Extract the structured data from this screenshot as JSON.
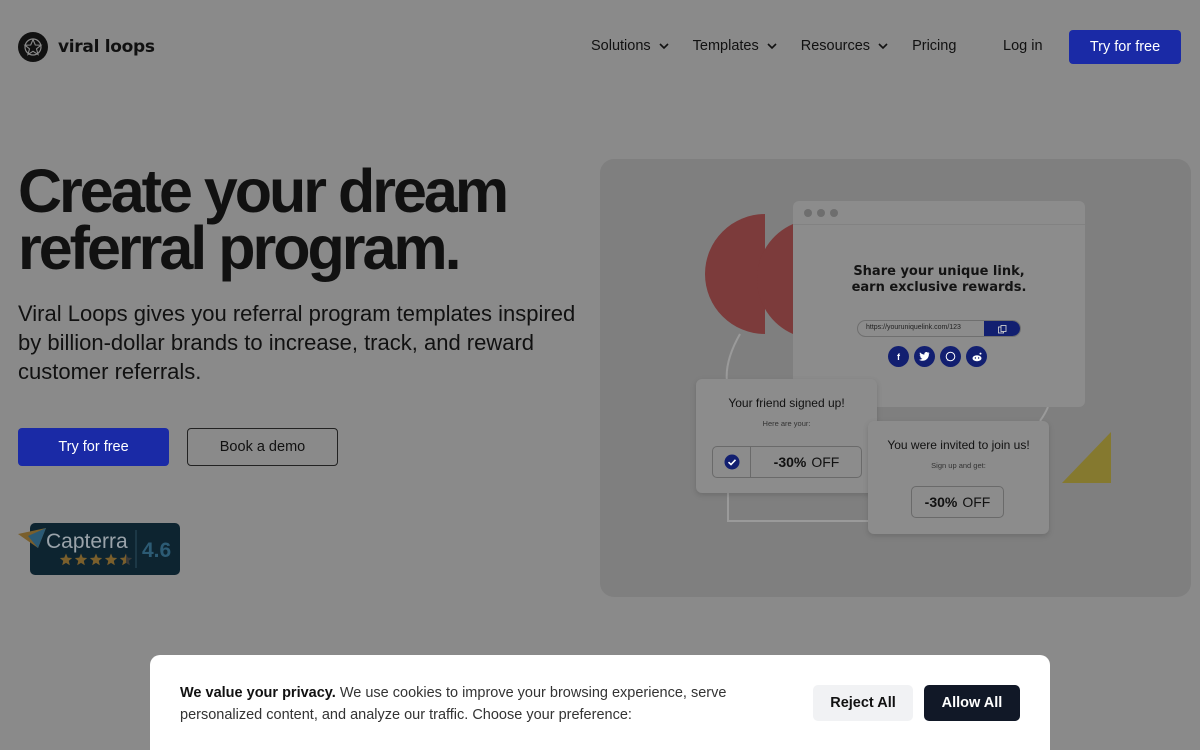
{
  "header": {
    "logo_text": "viral loops",
    "menu": [
      {
        "label": "Solutions",
        "has_dropdown": true
      },
      {
        "label": "Templates",
        "has_dropdown": true
      },
      {
        "label": "Resources",
        "has_dropdown": true
      },
      {
        "label": "Pricing",
        "has_dropdown": false
      }
    ],
    "login_label": "Log in",
    "cta_label": "Try for free"
  },
  "hero": {
    "title_line1": "Create your dream",
    "title_line2": "referral program.",
    "subtitle": "Viral Loops gives you referral program templates inspired by billion-dollar brands to increase, track, and reward customer referrals.",
    "primary_cta": "Try for free",
    "secondary_cta": "Book a demo"
  },
  "capterra": {
    "brand": "Capterra",
    "rating": "4.6",
    "stars": 4.5
  },
  "illustration": {
    "share_title_line1": "Share your unique link,",
    "share_title_line2": "earn exclusive rewards.",
    "link_text": "https://youruniquelink.com/123",
    "social_icons": [
      "facebook-icon",
      "twitter-icon",
      "whatsapp-icon",
      "reddit-icon"
    ],
    "card1": {
      "title": "Your friend signed up!",
      "subtitle": "Here are your:",
      "discount": "-30%",
      "discount_suffix": "OFF"
    },
    "card2": {
      "title": "You were invited to join us!",
      "subtitle": "Sign up and get:",
      "discount": "-30%",
      "discount_suffix": "OFF"
    }
  },
  "cookie": {
    "lead": "We value your privacy.",
    "text": "We use cookies to improve your browsing experience, serve personalized content, and analyze our traffic. Choose your preference:",
    "reject_label": "Reject All",
    "allow_label": "Allow All"
  },
  "colors": {
    "primary": "#1a2aa6",
    "overlay_bg": "#8a8a8a",
    "dark_button": "#111827",
    "illus_red": "#7c3b3b",
    "illus_yellow": "#85792f"
  }
}
